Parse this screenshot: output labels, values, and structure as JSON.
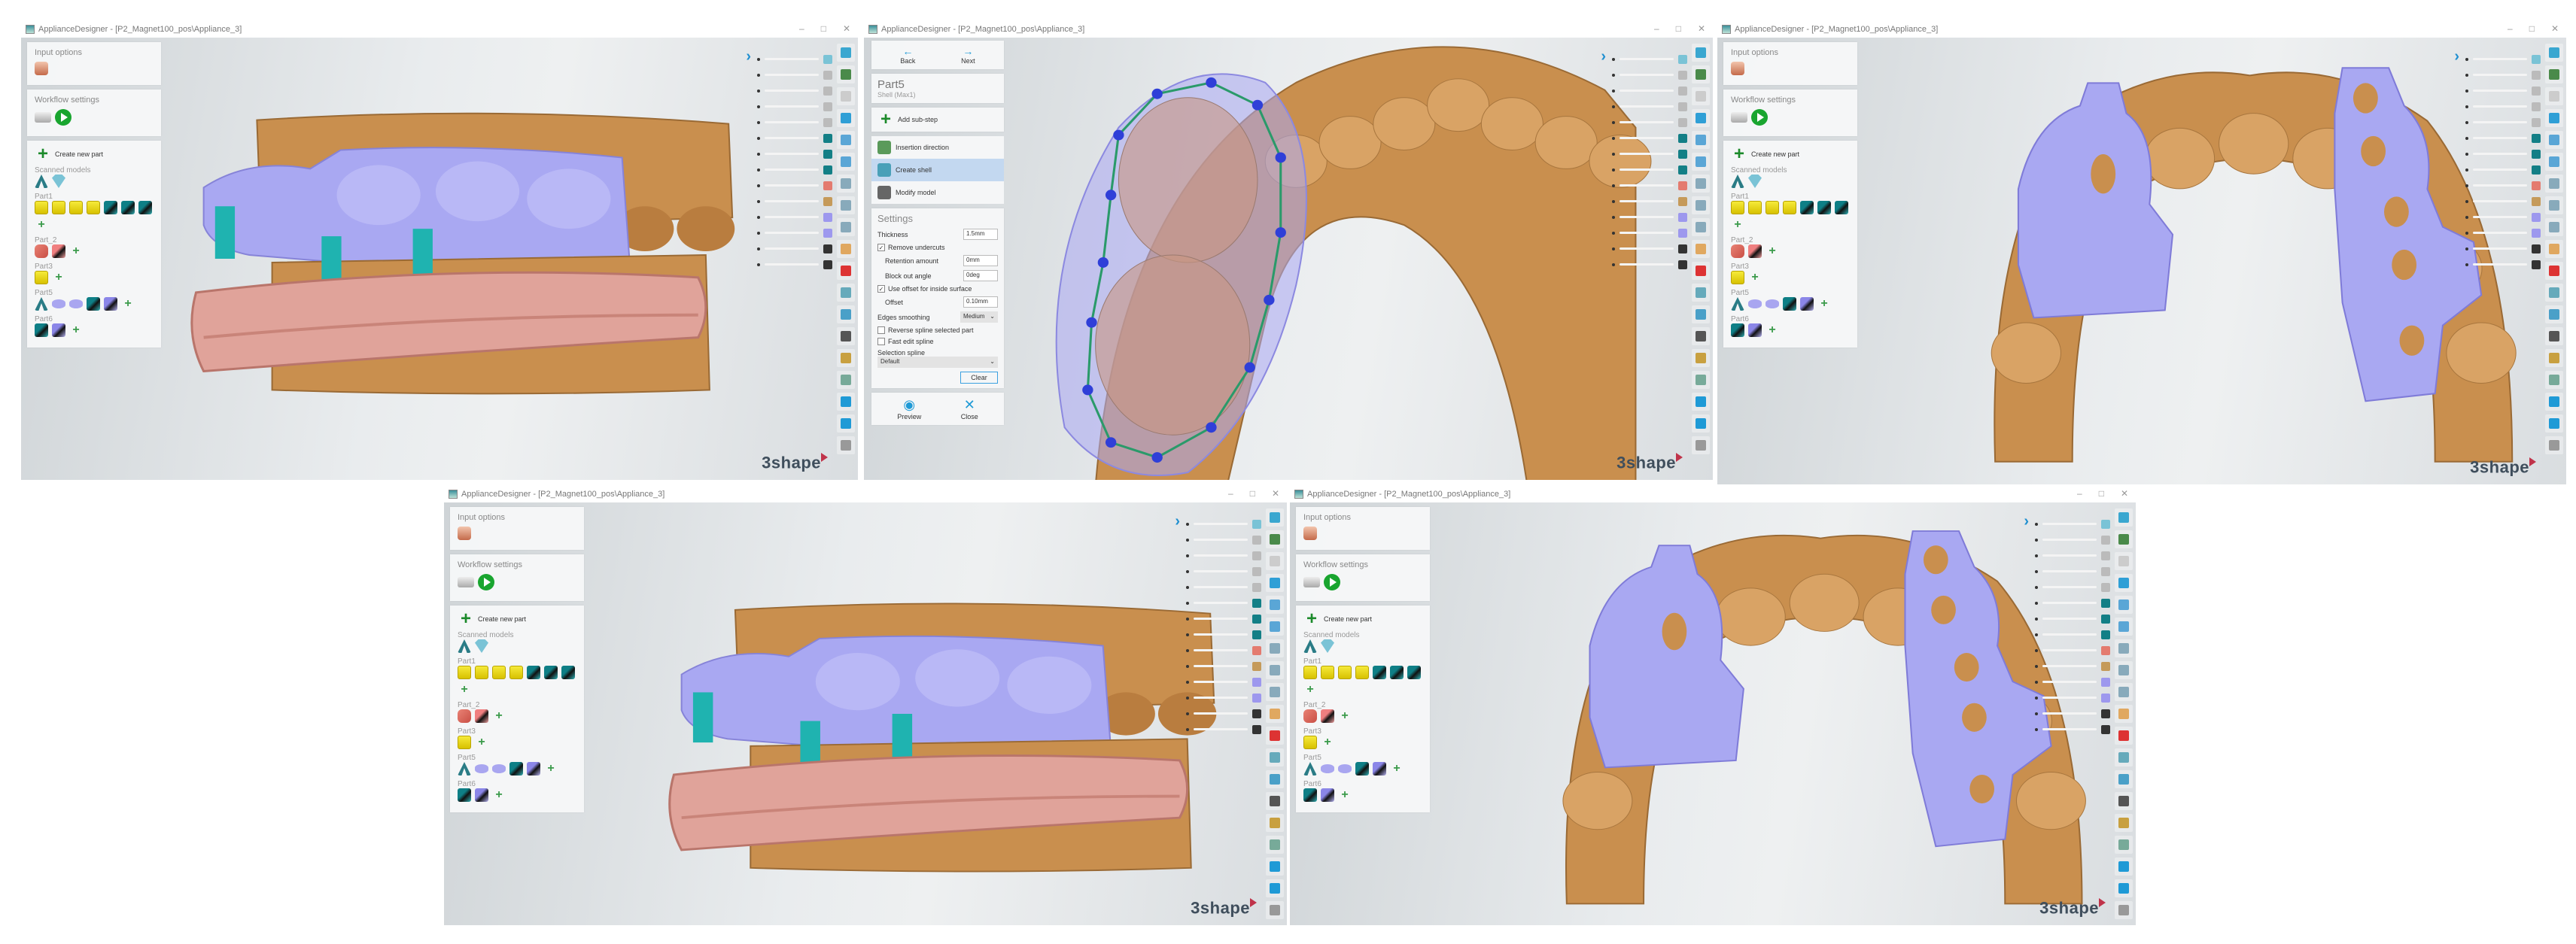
{
  "window_title": "ApplianceDesigner - [P2_Magnet100_pos\\Appliance_3]",
  "window_controls": [
    "–",
    "□",
    "✕"
  ],
  "logo_text": "3shape",
  "sidebar": {
    "input_options": "Input options",
    "workflow_settings": "Workflow settings",
    "create_new_part": "Create new part",
    "scanned_models": "Scanned models",
    "scanned_icons": [
      "arch",
      "gem"
    ],
    "parts": [
      {
        "label": "Part1",
        "icons": [
          "die",
          "die",
          "die",
          "die",
          "teal",
          "teal",
          "teal",
          "add"
        ]
      },
      {
        "label": "Part_2",
        "icons": [
          "pink",
          "pinkteal",
          "add"
        ]
      },
      {
        "label": "Part3",
        "icons": [
          "die",
          "add"
        ]
      },
      {
        "label": "Part5",
        "icons": [
          "arch",
          "lav",
          "lav",
          "teal",
          "lavteal",
          "add"
        ]
      },
      {
        "label": "Part6",
        "icons": [
          "teal",
          "lavteal",
          "add"
        ]
      }
    ]
  },
  "wizard": {
    "back": "Back",
    "next": "Next",
    "part_name": "Part5",
    "part_type": "Shell (Max1)",
    "add_sub_step": "Add sub-step",
    "steps": [
      "Insertion direction",
      "Create shell",
      "Modify model"
    ],
    "selected_step": 1,
    "settings_title": "Settings",
    "thickness_label": "Thickness",
    "thickness_value": "1.5mm",
    "remove_undercuts": "Remove undercuts",
    "retention_label": "Retention amount",
    "retention_value": "0mm",
    "blockout_label": "Block out angle",
    "blockout_value": "0deg",
    "use_offset": "Use offset for inside surface",
    "offset_label": "Offset",
    "offset_value": "0.10mm",
    "edges_label": "Edges smoothing",
    "edges_value": "Medium",
    "reverse_spline": "Reverse spline selected part",
    "fast_edit": "Fast edit spline",
    "selection_spline_label": "Selection spline",
    "selection_spline_value": "Default",
    "clear": "Clear",
    "preview": "Preview",
    "close": "Close"
  },
  "colors": {
    "model": "#c98f4e",
    "shell": "#a9a8f2",
    "base": "#e0a39a",
    "connector": "#1fb3b0",
    "accent": "#1f8fd0"
  },
  "slider_thumbs": [
    "gem",
    "die",
    "die",
    "die",
    "die",
    "teal",
    "teal",
    "teal",
    "pink",
    "arch",
    "lav",
    "lav",
    "dark",
    "dark"
  ],
  "tool_icons": [
    "rotate",
    "views",
    "grid",
    "view-front",
    "view-back",
    "view-left",
    "view-right",
    "view-top",
    "view-bottom",
    "box",
    "drop",
    "mountain",
    "cup",
    "select",
    "lamp",
    "pin",
    "undo",
    "redo",
    "disk"
  ],
  "panels": [
    {
      "id": "p1",
      "scene": "side",
      "sidebar": "parts"
    },
    {
      "id": "p2",
      "scene": "closeup",
      "sidebar": "wizard"
    },
    {
      "id": "p3",
      "scene": "occlusal",
      "sidebar": "parts"
    },
    {
      "id": "p4",
      "scene": "side",
      "sidebar": "parts"
    },
    {
      "id": "p5",
      "scene": "occlusal",
      "sidebar": "parts"
    }
  ]
}
